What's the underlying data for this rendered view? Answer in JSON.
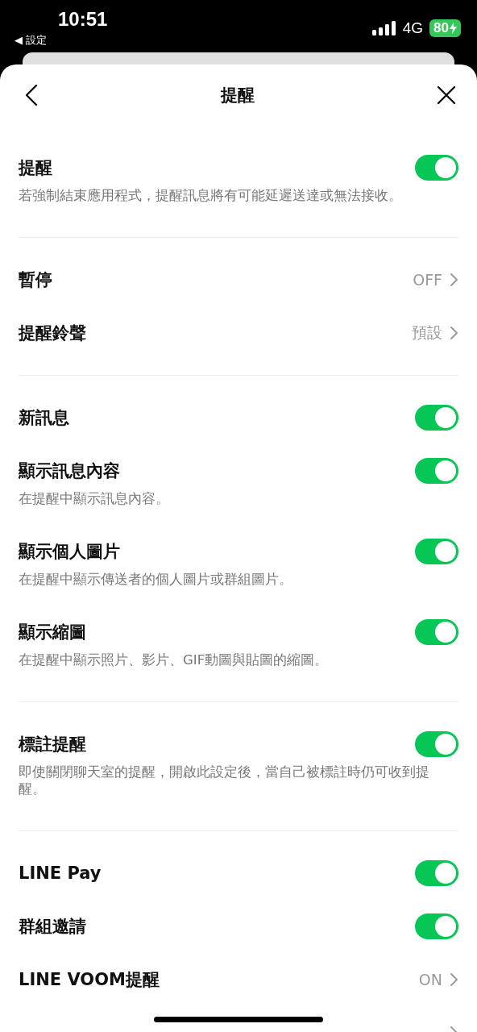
{
  "status_bar": {
    "time": "10:51",
    "back_app": "◀ 設定",
    "network": "4G",
    "battery": "80",
    "charging": true
  },
  "header": {
    "title": "提醒"
  },
  "sections": [
    {
      "items": [
        {
          "kind": "toggle",
          "label": "提醒",
          "description": "若強制結束應用程式，提醒訊息將有可能延遲送達或無法接收。",
          "on": true
        }
      ]
    },
    {
      "items": [
        {
          "kind": "link",
          "label": "暫停",
          "value": "OFF"
        },
        {
          "kind": "link",
          "label": "提醒鈴聲",
          "value": "預設"
        }
      ]
    },
    {
      "items": [
        {
          "kind": "toggle",
          "label": "新訊息",
          "on": true
        },
        {
          "kind": "toggle",
          "label": "顯示訊息內容",
          "description": "在提醒中顯示訊息內容。",
          "on": true
        },
        {
          "kind": "toggle",
          "label": "顯示個人圖片",
          "description": "在提醒中顯示傳送者的個人圖片或群組圖片。",
          "on": true
        },
        {
          "kind": "toggle",
          "label": "顯示縮圖",
          "description": "在提醒中顯示照片、影片、GIF動圖與貼圖的縮圖。",
          "on": true
        }
      ]
    },
    {
      "items": [
        {
          "kind": "toggle",
          "label": "標註提醒",
          "description": "即使關閉聊天室的提醒，開啟此設定後，當自己被標註時仍可收到提醒。",
          "on": true
        }
      ]
    },
    {
      "items": [
        {
          "kind": "toggle",
          "label": "LINE Pay",
          "on": true
        },
        {
          "kind": "toggle",
          "label": "群組邀請",
          "on": true
        },
        {
          "kind": "link",
          "label": "LINE VOOM提醒",
          "value": "ON"
        },
        {
          "kind": "link"
        }
      ]
    }
  ]
}
